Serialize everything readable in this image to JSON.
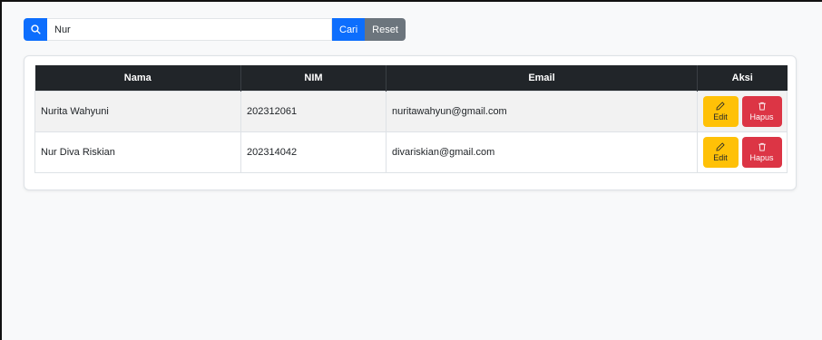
{
  "search": {
    "value": "Nur",
    "icon": "search-icon",
    "cari_label": "Cari",
    "reset_label": "Reset"
  },
  "table": {
    "headers": [
      "Nama",
      "NIM",
      "Email",
      "Aksi"
    ],
    "rows": [
      {
        "nama": "Nurita Wahyuni",
        "nim": "202312061",
        "email": "nuritawahyun@gmail.com"
      },
      {
        "nama": "Nur Diva Riskian",
        "nim": "202314042",
        "email": "divariskian@gmail.com"
      }
    ],
    "edit_label": "Edit",
    "hapus_label": "Hapus",
    "edit_icon": "pencil-icon",
    "hapus_icon": "trash-icon"
  },
  "colors": {
    "primary": "#0d6efd",
    "secondary": "#6c757d",
    "warning": "#ffc107",
    "danger": "#dc3545",
    "header_dark": "#212529"
  }
}
